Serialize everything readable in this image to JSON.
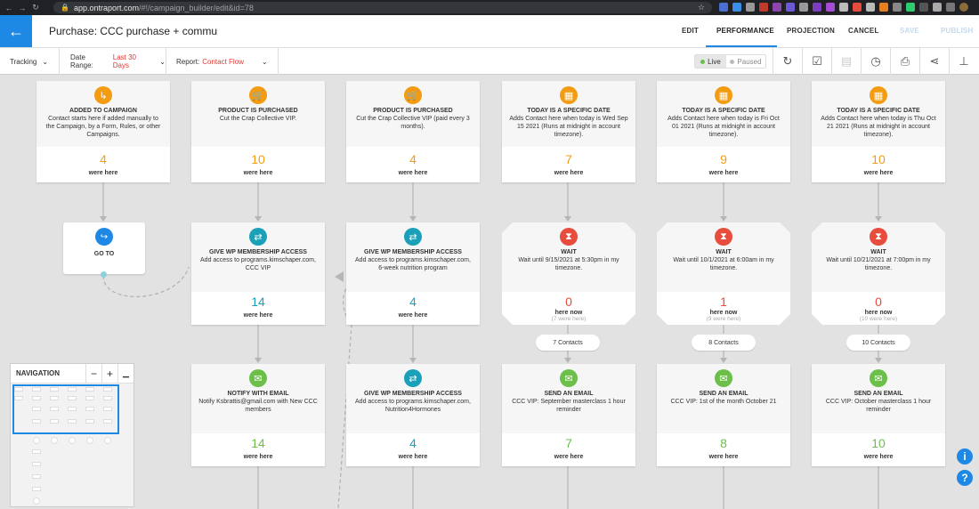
{
  "browser": {
    "url_host": "app.ontraport.com",
    "url_path": "/#!/campaign_builder/edit&id=78"
  },
  "header": {
    "title": "Purchase: CCC purchase + communicati",
    "nav": {
      "edit": "EDIT",
      "performance": "PERFORMANCE",
      "projection": "PROJECTION",
      "cancel": "CANCEL",
      "save": "SAVE",
      "publish": "PUBLISH"
    },
    "accent": "#1e88e5"
  },
  "toolbar": {
    "tracking": "Tracking",
    "date_range_label": "Date Range:",
    "date_range_value": "Last 30 Days",
    "report_label": "Report:",
    "report_value": "Contact Flow",
    "live": "Live",
    "paused": "Paused"
  },
  "row1": [
    {
      "title": "ADDED TO CAMPAIGN",
      "desc": "Contact starts here if added manually to the Campaign, by a Form, Rules, or other Campaigns.",
      "count": "4",
      "label": "were here",
      "icon": "campaign-icon"
    },
    {
      "title": "PRODUCT IS PURCHASED",
      "desc": "Cut the Crap Collective VIP.",
      "count": "10",
      "label": "were here",
      "icon": "cart-icon"
    },
    {
      "title": "PRODUCT IS PURCHASED",
      "desc": "Cut the Crap Collective VIP (paid every 3 months).",
      "count": "4",
      "label": "were here",
      "icon": "cart-icon"
    },
    {
      "title": "TODAY IS A SPECIFIC DATE",
      "desc": "Adds Contact here when today is Wed Sep 15 2021 (Runs at midnight in account timezone).",
      "count": "7",
      "label": "were here",
      "icon": "calendar-icon"
    },
    {
      "title": "TODAY IS A SPECIFIC DATE",
      "desc": "Adds Contact here when today is Fri Oct 01 2021 (Runs at midnight in account timezone).",
      "count": "9",
      "label": "were here",
      "icon": "calendar-icon"
    },
    {
      "title": "TODAY IS A SPECIFIC DATE",
      "desc": "Adds Contact here when today is Thu Oct 21 2021 (Runs at midnight in account timezone).",
      "count": "10",
      "label": "were here",
      "icon": "calendar-icon"
    }
  ],
  "goto": {
    "title": "GO TO"
  },
  "row2": [
    {
      "title": "GIVE WP MEMBERSHIP ACCESS",
      "desc": "Add access to programs.kimschaper.com, CCC VIP",
      "count": "14",
      "label": "were here"
    },
    {
      "title": "GIVE WP MEMBERSHIP ACCESS",
      "desc": "Add access to programs.kimschaper.com, 6-week nutrition program",
      "count": "4",
      "label": "were here"
    },
    {
      "title": "WAIT",
      "desc": "Wait until 9/15/2021 at 5:30pm in my timezone.",
      "count": "0",
      "label": "here now",
      "sub": "(7 were here)",
      "pill": "7 Contacts"
    },
    {
      "title": "WAIT",
      "desc": "Wait until 10/1/2021 at 6:00am in my timezone.",
      "count": "1",
      "label": "here now",
      "sub": "(9 were here)",
      "pill": "8 Contacts"
    },
    {
      "title": "WAIT",
      "desc": "Wait until 10/21/2021 at 7:00pm in my timezone.",
      "count": "0",
      "label": "here now",
      "sub": "(10 were here)",
      "pill": "10 Contacts"
    }
  ],
  "row3": [
    {
      "title": "NOTIFY WITH EMAIL",
      "desc": "Notify Ksbrattis@gmail.com with New CCC members",
      "count": "14",
      "label": "were here"
    },
    {
      "title": "GIVE WP MEMBERSHIP ACCESS",
      "desc": "Add access to programs.kimschaper.com, Nutrition4Hormones",
      "count": "4",
      "label": "were here"
    },
    {
      "title": "SEND AN EMAIL",
      "desc": "CCC VIP: September masterclass 1 hour reminder",
      "count": "7",
      "label": "were here"
    },
    {
      "title": "SEND AN EMAIL",
      "desc": "CCC VIP: 1st of the month October 21",
      "count": "8",
      "label": "were here"
    },
    {
      "title": "SEND AN EMAIL",
      "desc": "CCC VIP: October masterclass 1 hour reminder",
      "count": "10",
      "label": "were here"
    }
  ],
  "navigation": {
    "title": "NAVIGATION",
    "zoom_out": "−",
    "zoom_in": "+"
  },
  "help": {
    "info": "i",
    "question": "?"
  }
}
